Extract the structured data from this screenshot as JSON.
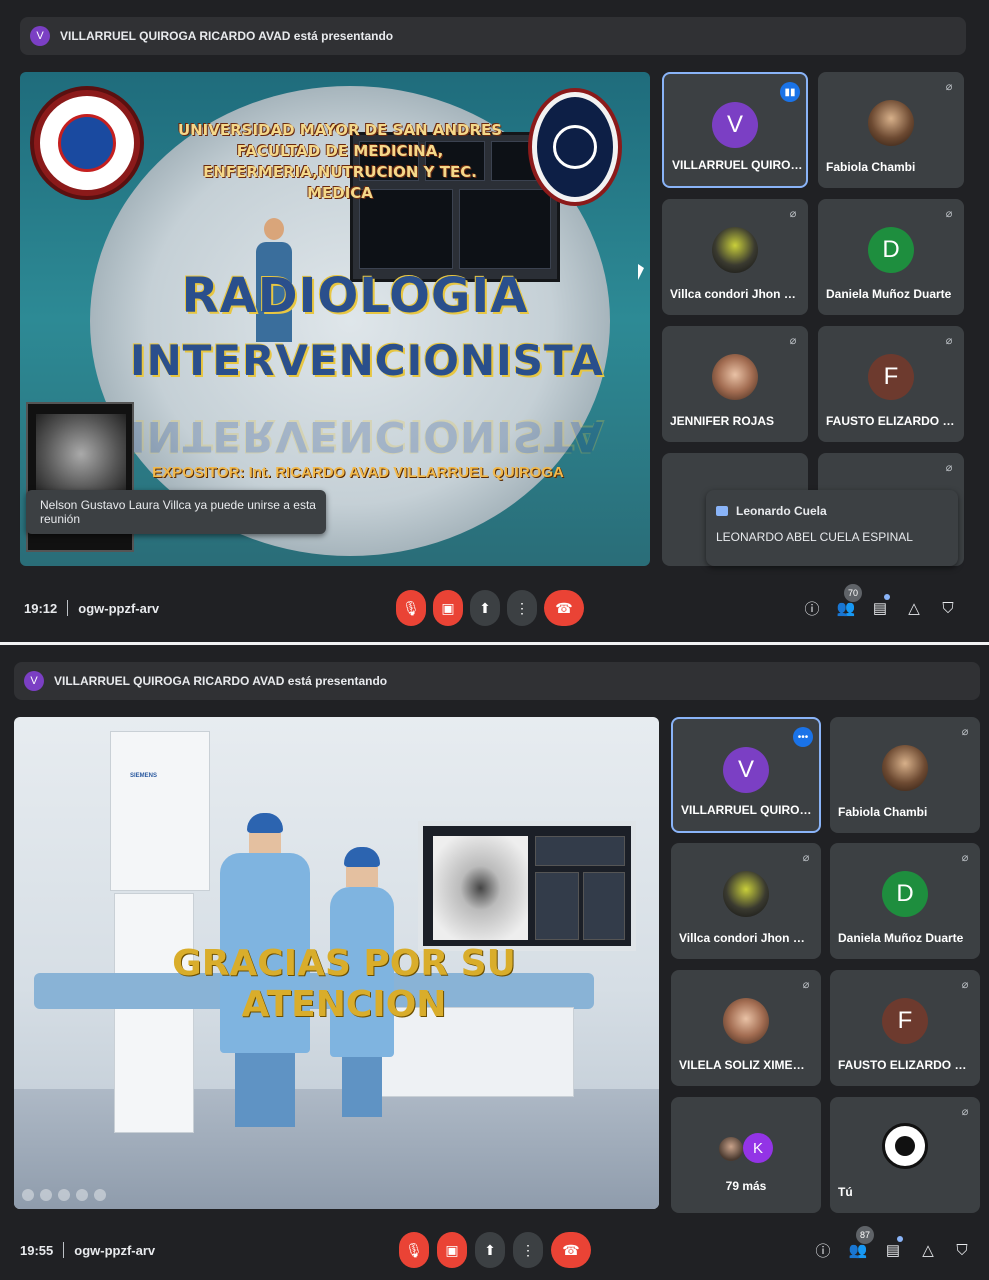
{
  "screen1": {
    "presenting": {
      "avatar": "V",
      "text": "VILLARRUEL QUIROGA RICARDO AVAD está presentando"
    },
    "slide": {
      "university_lines": [
        "UNIVERSIDAD MAYOR DE SAN ANDRES",
        "FACULTAD DE MEDICINA,",
        "ENFERMERIA,NUTRUCION Y TEC. MEDICA"
      ],
      "title_line1": "RADIOLOGIA",
      "title_line2": "INTERVENCIONISTA",
      "title_reflection": "INTERVENCIONISTA",
      "expositor": "EXPOSITOR: Int. RICARDO AVAD VILLARRUEL QUIROGA",
      "logo_left": "CARRERA DE MEDICINA UMSA",
      "logo_right": "IMAGENOLOGIA UMSA"
    },
    "toast": "Nelson Gustavo Laura Villca ya puede unirse a esta reunión",
    "tiles": [
      {
        "name": "VILLARRUEL QUIROGA RI...",
        "avatar": "V",
        "color": "#7b3fc4",
        "speaking": true
      },
      {
        "name": "Fabiola Chambi",
        "photo": true
      },
      {
        "name": "Villca condori Jhon braian",
        "photo": true
      },
      {
        "name": "Daniela Muñoz Duarte",
        "avatar": "D",
        "color": "#1e8e3e"
      },
      {
        "name": "JENNIFER ROJAS",
        "photo": true
      },
      {
        "name": "FAUSTO ELIZARDO QUIN...",
        "avatar": "F",
        "color": "#6d3a2e"
      }
    ],
    "chat": {
      "sender": "Leonardo Cuela",
      "message": "LEONARDO ABEL CUELA ESPINAL"
    },
    "bottom": {
      "time": "19:12",
      "code": "ogw-ppzf-arv",
      "participants": "70"
    }
  },
  "screen2": {
    "presenting": {
      "avatar": "V",
      "text": "VILLARRUEL QUIROGA RICARDO AVAD está presentando"
    },
    "slide": {
      "text": "GRACIAS POR SU ATENCION",
      "brand": "SIEMENS"
    },
    "tiles": [
      {
        "name": "VILLARRUEL QUIROGA RI...",
        "avatar": "V",
        "color": "#7b3fc4"
      },
      {
        "name": "Fabiola Chambi",
        "photo": true
      },
      {
        "name": "Villca condori Jhon braian",
        "photo": true
      },
      {
        "name": "Daniela Muñoz Duarte",
        "avatar": "D",
        "color": "#1e8e3e"
      },
      {
        "name": "VILELA SOLIZ XIMENA SC...",
        "photo": true
      },
      {
        "name": "FAUSTO ELIZARDO QUIN...",
        "avatar": "F",
        "color": "#6d3a2e"
      }
    ],
    "more": {
      "avatar": "K",
      "label": "79 más"
    },
    "you": {
      "label": "Tú"
    },
    "bottom": {
      "time": "19:55",
      "code": "ogw-ppzf-arv",
      "participants": "87"
    }
  },
  "icons": {
    "mic_off": "🎙",
    "cam_off": "▣",
    "present": "⬆",
    "more": "⋮",
    "hangup": "☎",
    "info": "ⓘ",
    "people": "👥",
    "chat": "▤",
    "activities": "△",
    "shield": "⛉"
  }
}
